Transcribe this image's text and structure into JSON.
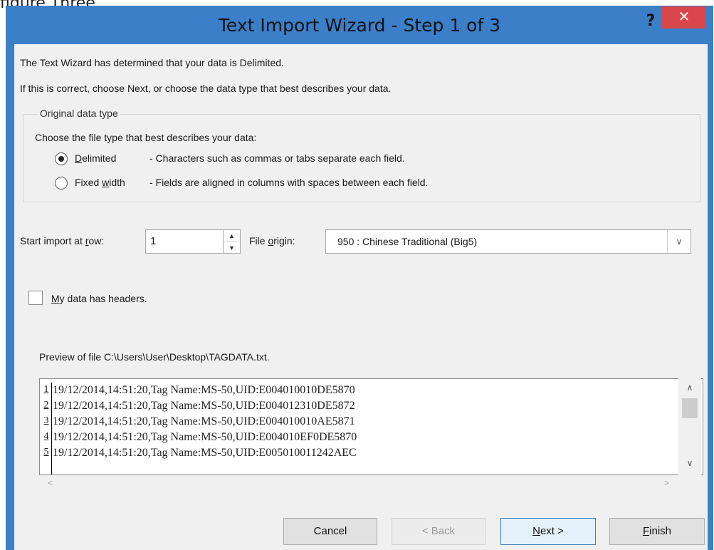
{
  "page": {
    "above_text": "figure Three"
  },
  "window": {
    "title": "Text Import Wizard - Step 1 of 3",
    "help_glyph": "?",
    "close_glyph": "✕"
  },
  "intro": {
    "line1": "The Text Wizard has determined that your data is Delimited.",
    "line2": "If this is correct, choose Next, or choose the data type that best describes your data."
  },
  "original_data_type": {
    "legend": "Original data type",
    "prompt": "Choose the file type that best describes your data:",
    "options": [
      {
        "mnemonic": "D",
        "label_rest": "elimited",
        "description": "- Characters such as commas or tabs separate each field.",
        "selected": true
      },
      {
        "label_pre": "Fixed ",
        "mnemonic": "w",
        "label_rest": "idth",
        "description": "- Fields are aligned in columns with spaces between each field.",
        "selected": false
      }
    ]
  },
  "start_row": {
    "label_pre": "Start import at ",
    "mnemonic": "r",
    "label_rest": "ow:",
    "value": "1"
  },
  "file_origin": {
    "label_pre": "File ",
    "mnemonic": "o",
    "label_rest": "rigin:",
    "value": "950 : Chinese Traditional (Big5)"
  },
  "headers_checkbox": {
    "mnemonic": "M",
    "label_rest": "y data has headers.",
    "checked": false
  },
  "preview": {
    "label": "Preview of file C:\\Users\\User\\Desktop\\TAGDATA.txt.",
    "rows": [
      {
        "num": "1",
        "text": "19/12/2014,14:51:20,Tag Name:MS-50,UID:E004010010DE5870"
      },
      {
        "num": "2",
        "text": "19/12/2014,14:51:20,Tag Name:MS-50,UID:E004012310DE5872"
      },
      {
        "num": "3",
        "text": "19/12/2014,14:51:20,Tag Name:MS-50,UID:E004010010AE5871"
      },
      {
        "num": "4",
        "text": "19/12/2014,14:51:20,Tag Name:MS-50,UID:E004010EF0DE5870"
      },
      {
        "num": "5",
        "text": "19/12/2014,14:51:20,Tag Name:MS-50,UID:E005010011242AEC"
      }
    ]
  },
  "buttons": {
    "cancel": "Cancel",
    "back": "< Back",
    "next_mnemonic": "N",
    "next_rest": "ext >",
    "finish_mnemonic": "F",
    "finish_rest": "inish"
  }
}
